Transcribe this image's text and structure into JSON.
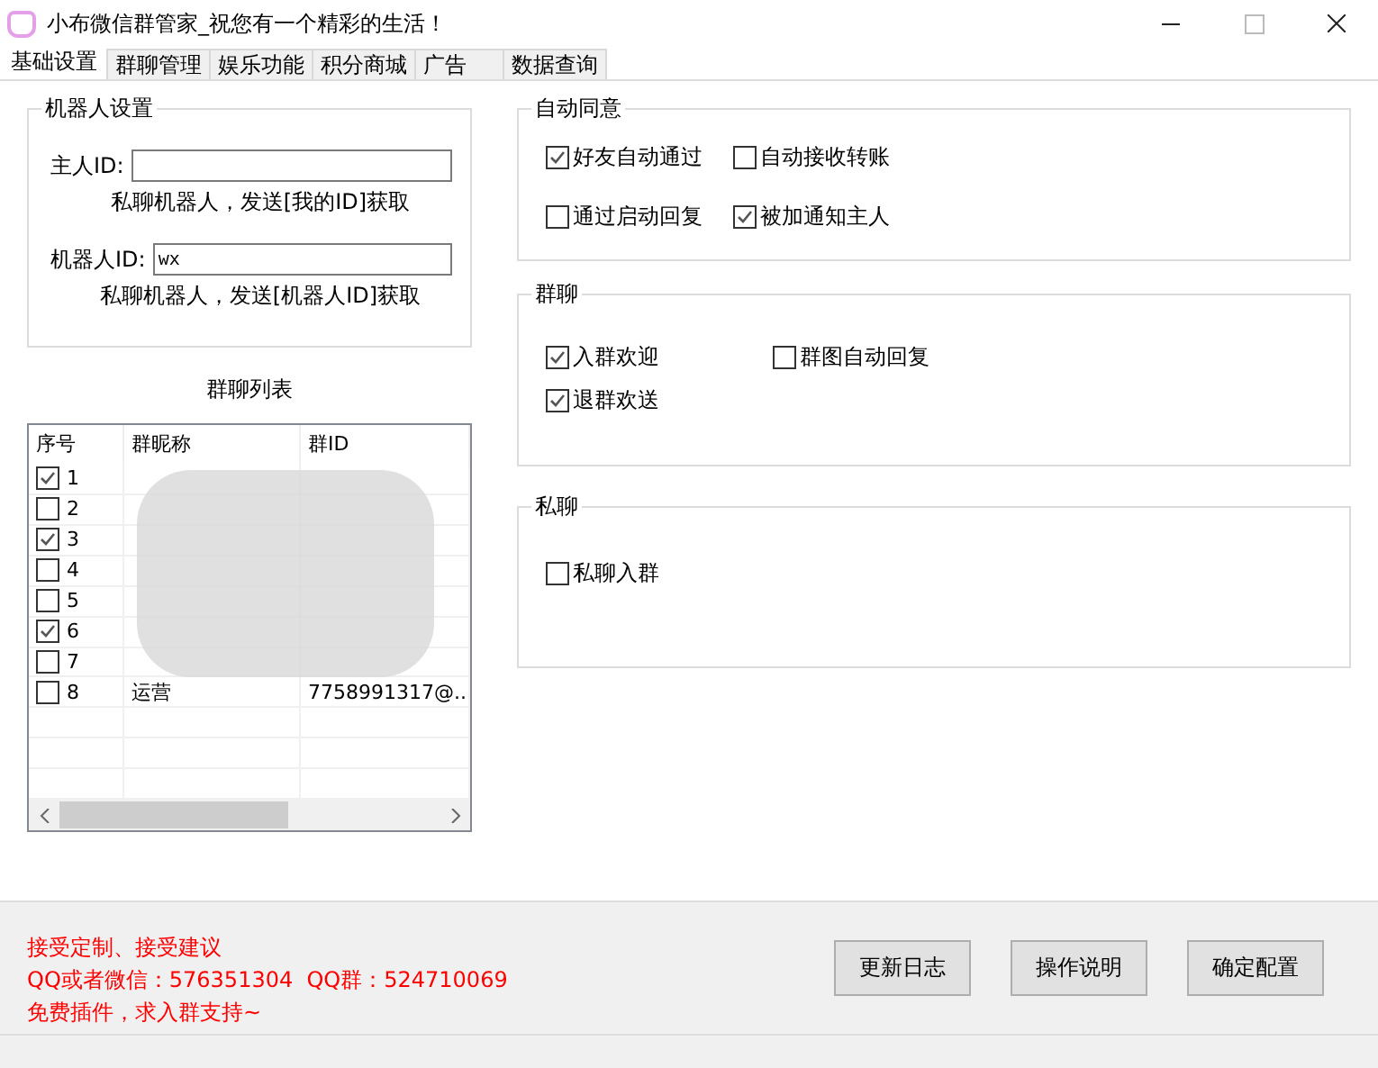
{
  "window": {
    "title": "小布微信群管家_祝您有一个精彩的生活！"
  },
  "tabs": [
    {
      "label": "基础设置",
      "selected": true
    },
    {
      "label": "群聊管理",
      "selected": false
    },
    {
      "label": "娱乐功能",
      "selected": false
    },
    {
      "label": "积分商城",
      "selected": false
    },
    {
      "label": "广告",
      "selected": false
    },
    {
      "label": "数据查询",
      "selected": false
    }
  ],
  "robot_settings": {
    "title": "机器人设置",
    "fields": [
      {
        "label": "主人ID:",
        "hint": "私聊机器人，发送[我的ID]获取"
      },
      {
        "label": "机器人ID:",
        "value": "wx",
        "hint": "私聊机器人，发送[机器人ID]获取"
      }
    ]
  },
  "group_list": {
    "title": "群聊列表",
    "columns": [
      "序号",
      "群昵称",
      "群ID"
    ],
    "rows": [
      {
        "index": "1",
        "checked": true
      },
      {
        "index": "2",
        "checked": false
      },
      {
        "index": "3",
        "checked": true
      },
      {
        "index": "4",
        "checked": false
      },
      {
        "index": "5",
        "checked": false
      },
      {
        "index": "6",
        "checked": true
      },
      {
        "index": "7",
        "checked": false
      },
      {
        "index": "8",
        "checked": false,
        "name": "运营",
        "id": "7758991317@..."
      }
    ]
  },
  "option_groups": [
    {
      "title": "自动同意",
      "rows": [
        [
          {
            "label": "好友自动通过",
            "checked": true
          },
          {
            "label": "自动接收转账",
            "checked": false
          }
        ],
        [
          {
            "label": "通过启动回复",
            "checked": false
          },
          {
            "label": "被加通知主人",
            "checked": true
          }
        ]
      ]
    },
    {
      "title": "群聊",
      "rows": [
        [
          {
            "label": "入群欢迎",
            "checked": true
          },
          {
            "label": "群图自动回复",
            "checked": false
          }
        ],
        [
          {
            "label": "退群欢送",
            "checked": true
          }
        ]
      ]
    },
    {
      "title": "私聊",
      "rows": [
        [
          {
            "label": "私聊入群",
            "checked": false
          }
        ]
      ]
    }
  ],
  "footer": {
    "notes": [
      "接受定制、接受建议",
      "QQ或者微信：576351304  QQ群：524710069",
      "免费插件，求入群支持~"
    ],
    "buttons": [
      "更新日志",
      "操作说明",
      "确定配置"
    ]
  }
}
